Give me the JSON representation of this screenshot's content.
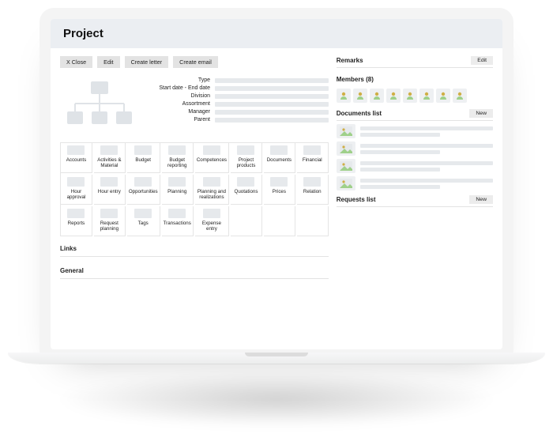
{
  "header": {
    "title": "Project"
  },
  "toolbar": {
    "close": "X  Close",
    "edit": "Edit",
    "create_letter": "Create letter",
    "create_email": "Create email"
  },
  "fields": [
    "Type",
    "Start date - End date",
    "Division",
    "Assortment",
    "Manager",
    "Parent"
  ],
  "tiles": [
    "Accounts",
    "Activities & Material",
    "Budget",
    "Budget reporting",
    "Competences",
    "Project products",
    "Documents",
    "Financial",
    "Hour approval",
    "Hour entry",
    "Opportunities",
    "Planning",
    "Planning and realizations",
    "Quotations",
    "Prices",
    "Relation",
    "Reports",
    "Request planning",
    "Tags",
    "Transactions",
    "Expense entry",
    "",
    "",
    ""
  ],
  "left_sections": {
    "links": "Links",
    "general": "General"
  },
  "right": {
    "remarks": {
      "title": "Remarks",
      "edit": "Edit"
    },
    "members": {
      "title": "Members (8)",
      "count": 8
    },
    "documents": {
      "title": "Documents list",
      "new": "New",
      "rows": 4
    },
    "requests": {
      "title": "Requests list",
      "new": "New"
    }
  }
}
